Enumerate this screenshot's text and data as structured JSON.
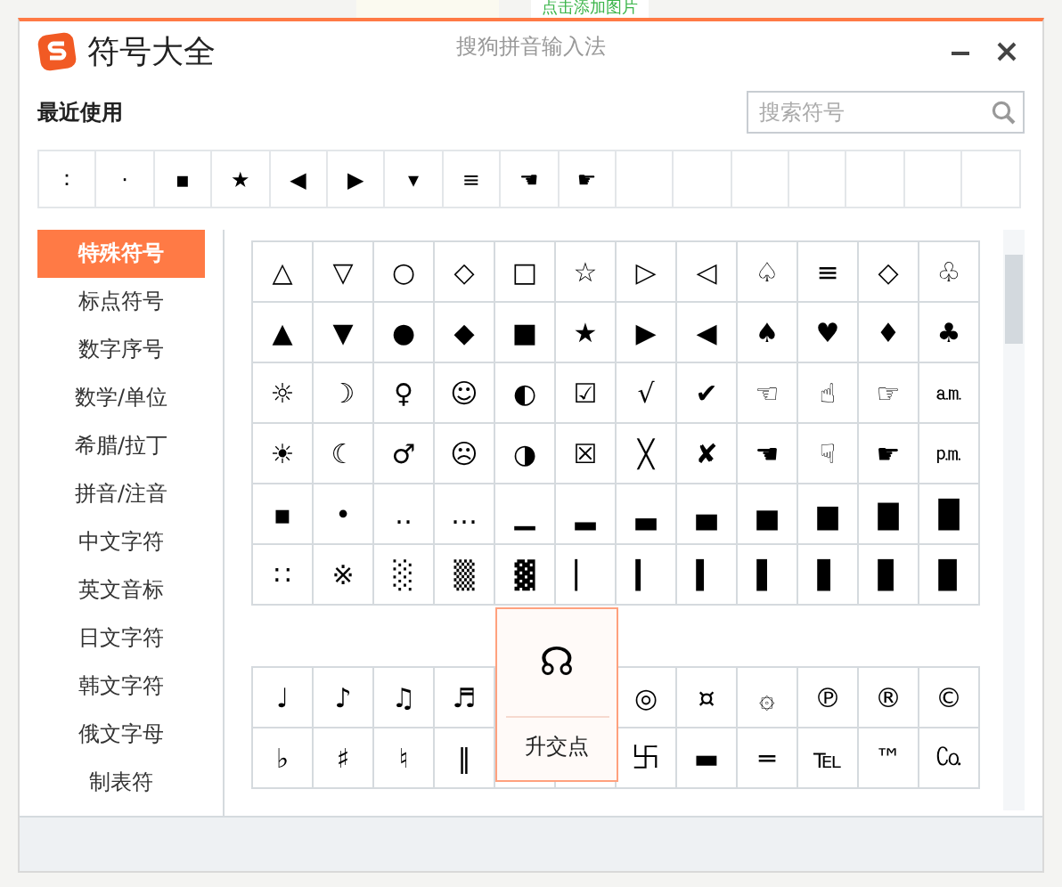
{
  "backdrop": {
    "link": "点击添加图片"
  },
  "window": {
    "title": "符号大全",
    "app_name": "搜狗拼音输入法"
  },
  "recent": {
    "label": "最近使用",
    "symbols": [
      "：",
      "·",
      "▪",
      "★",
      "◀",
      "▶",
      "▾",
      "≡",
      "☚",
      "☛"
    ]
  },
  "search": {
    "placeholder": "搜索符号"
  },
  "sidebar": {
    "items": [
      {
        "label": "特殊符号",
        "selected": true
      },
      {
        "label": "标点符号",
        "selected": false
      },
      {
        "label": "数字序号",
        "selected": false
      },
      {
        "label": "数学/单位",
        "selected": false
      },
      {
        "label": "希腊/拉丁",
        "selected": false
      },
      {
        "label": "拼音/注音",
        "selected": false
      },
      {
        "label": "中文字符",
        "selected": false
      },
      {
        "label": "英文音标",
        "selected": false
      },
      {
        "label": "日文字符",
        "selected": false
      },
      {
        "label": "韩文字符",
        "selected": false
      },
      {
        "label": "俄文字母",
        "selected": false
      },
      {
        "label": "制表符",
        "selected": false
      }
    ]
  },
  "grids": [
    {
      "rows": [
        [
          "△",
          "▽",
          "○",
          "◇",
          "□",
          "☆",
          "▷",
          "◁",
          "♤",
          "≡",
          "◇",
          "♧"
        ],
        [
          "▲",
          "▼",
          "●",
          "◆",
          "■",
          "★",
          "▶",
          "◀",
          "♠",
          "♥",
          "♦",
          "♣"
        ],
        [
          "☼",
          "☽",
          "♀",
          "☺",
          "◐",
          "☑",
          "√",
          "✔",
          "☜",
          "☝",
          "☞",
          "㏂"
        ],
        [
          "☀",
          "☾",
          "♂",
          "☹",
          "◑",
          "☒",
          "╳",
          "✘",
          "☚",
          "☟",
          "☛",
          "㏘"
        ],
        [
          "▪",
          "•",
          "‥",
          "…",
          "▁",
          "▂",
          "▃",
          "▄",
          "▅",
          "▆",
          "▇",
          "█"
        ],
        [
          "∷",
          "※",
          "░",
          "▒",
          "▓",
          "▏",
          "▎",
          "▍",
          "▌",
          "▋",
          "▊",
          "▉"
        ]
      ]
    },
    {
      "rows": [
        [
          "♩",
          "♪",
          "♫",
          "♬",
          null,
          null,
          "◎",
          "¤",
          "۞",
          "℗",
          "®",
          "©"
        ],
        [
          "♭",
          "♯",
          "♮",
          "‖",
          null,
          null,
          "卐",
          "▬",
          "═",
          "℡",
          "™",
          "㏇"
        ]
      ]
    }
  ],
  "tooltip": {
    "symbol": "☊",
    "name": "升交点"
  }
}
